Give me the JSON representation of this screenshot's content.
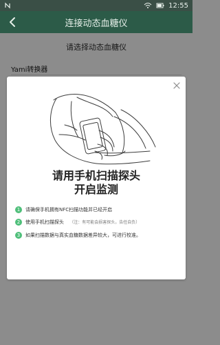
{
  "statusbar": {
    "time": "12:55",
    "icons": [
      "nfc-icon",
      "wifi-icon",
      "battery-icon"
    ]
  },
  "appbar": {
    "title": "连接动态血糖仪",
    "back_icon": "chevron-left-icon"
  },
  "content": {
    "header": "请选择动态血糖仪",
    "device_name": "Yami转换器"
  },
  "dialog": {
    "close_icon": "close-icon",
    "headline_line1": "请用手机扫描探头",
    "headline_line2": "开启监测",
    "steps": [
      {
        "num": "1",
        "text": "请确保手机拥有NFC扫描功能并已经开启",
        "note": ""
      },
      {
        "num": "2",
        "text": "使用手机扫描探头",
        "note": "（注：有可能会损害探头，告任自负）"
      },
      {
        "num": "3",
        "text": "如果扫描数据与真实血糖数据差异较大，可进行校准。",
        "note": ""
      }
    ]
  },
  "colors": {
    "statusbar_bg": "#3a4f46",
    "appbar_bg": "#2c5b48",
    "accent_green": "#4fbf7a",
    "dim_bg": "#8c8c8c"
  }
}
